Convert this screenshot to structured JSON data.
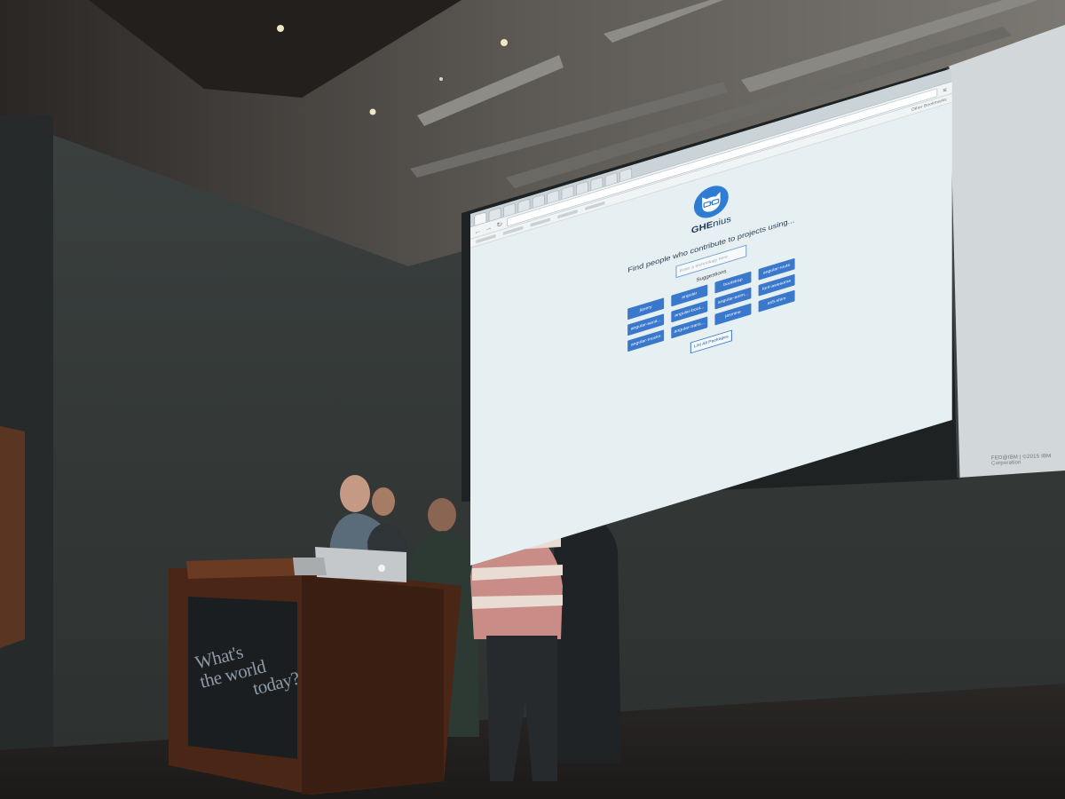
{
  "browser": {
    "tabs": [
      "",
      "",
      "",
      "",
      "",
      "",
      "",
      "",
      "",
      "",
      ""
    ],
    "url": "",
    "bookmarks_other": "Other Bookmarks"
  },
  "app": {
    "title_bold": "GHE",
    "title_light": "nius",
    "tagline": "Find people who contribute to projects using...",
    "search_placeholder": "Enter a technology here",
    "suggestions_label": "Suggestions",
    "suggestions": [
      "jquery",
      "angular",
      "bootstrap",
      "angular-route",
      "angular-sanit...",
      "angular-boot...",
      "angular-anim...",
      "font-awesome",
      "angular-mocks",
      "angular-trans...",
      "jasmine",
      "es5-shim"
    ],
    "list_all_label": "List All Packages"
  },
  "room": {
    "credit": "FED@IBM  |  ©2015 IBM Corporation",
    "podium_line1": "What's",
    "podium_line2": "the world",
    "podium_line3": "today?"
  },
  "colors": {
    "accent": "#3a78cc",
    "logo": "#2f7dd3",
    "screen": "#e6f0f3",
    "wall": "#3a403f"
  },
  "icons": {
    "logo": "octocat-glasses-icon"
  }
}
